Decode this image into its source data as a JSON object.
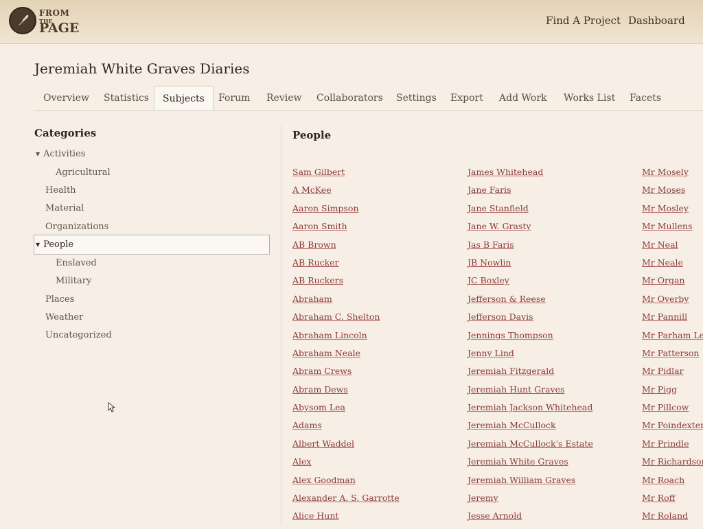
{
  "brand": {
    "line1": "FROM",
    "line2": "THE",
    "line3": "PAGE"
  },
  "nav": {
    "find_project": "Find A Project",
    "dashboard": "Dashboard"
  },
  "page_title": "Jeremiah White Graves Diaries",
  "tabs": [
    "Overview",
    "Statistics",
    "Subjects",
    "Forum",
    "Review",
    "Collaborators",
    "Settings",
    "Export",
    "Add Work",
    "Works List",
    "Facets"
  ],
  "active_tab": "Subjects",
  "categories": {
    "title": "Categories",
    "items": [
      "Activities",
      "Agricultural",
      "Health",
      "Material",
      "Organizations",
      "People",
      "Enslaved",
      "Military",
      "Places",
      "Weather",
      "Uncategorized"
    ],
    "selected": "People"
  },
  "people": {
    "title": "People",
    "columns": [
      [
        "Sam Gilbert",
        "A McKee",
        "Aaron Simpson",
        "Aaron Smith",
        "AB Brown",
        "AB Rucker",
        "AB Ruckers",
        "Abraham",
        "Abraham C. Shelton",
        "Abraham Lincoln",
        "Abraham Neale",
        "Abram Crews",
        "Abram Dews",
        "Abysom Lea",
        "Adams",
        "Albert Waddel",
        "Alex",
        "Alex Goodman",
        "Alexander A. S. Garrotte",
        "Alice Hunt"
      ],
      [
        "James Whitehead",
        "Jane Faris",
        "Jane Stanfield",
        "Jane W. Grasty",
        "Jas B Faris",
        "JB Nowlin",
        "JC Boxley",
        "Jefferson & Reese",
        "Jefferson Davis",
        "Jennings Thompson",
        "Jenny Lind",
        "Jeremiah Fitzgerald",
        "Jeremiah Hunt Graves",
        "Jeremiah Jackson Whitehead",
        "Jeremiah McCullock",
        "Jeremiah McCullock's Estate",
        "Jeremiah White Graves",
        "Jeremiah William Graves",
        "Jeremy",
        "Jesse Arnold"
      ],
      [
        "Mr Mosely",
        "Mr Moses",
        "Mr Mosley",
        "Mr Mullens",
        "Mr Neal",
        "Mr Neale",
        "Mr Organ",
        "Mr Overby",
        "Mr Pannill",
        "Mr Parham Lev",
        "Mr Patterson",
        "Mr Pidlar",
        "Mr Pigg",
        "Mr Pillcow",
        "Mr Poindexter",
        "Mr Prindle",
        "Mr Richardson",
        "Mr Roach",
        "Mr Roff",
        "Mr Roland"
      ]
    ]
  },
  "colors": {
    "link": "#8a3a36",
    "header_bg": "#e3d3b5",
    "page_bg": "#f7efe6"
  }
}
